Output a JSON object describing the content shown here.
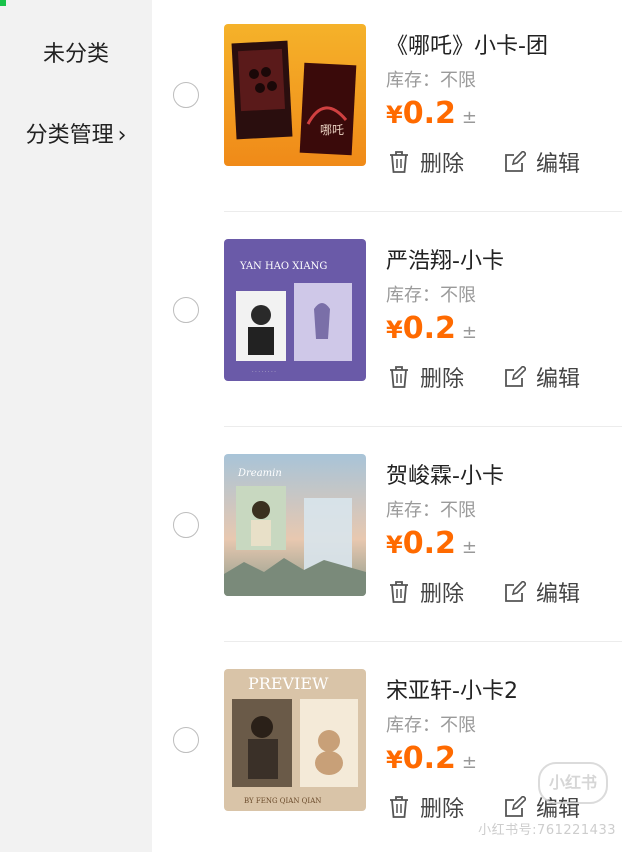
{
  "sidebar": {
    "items": [
      {
        "label": "未分类"
      },
      {
        "label": "分类管理"
      }
    ],
    "chevron_icon": "chevron-right-icon"
  },
  "products": [
    {
      "name": "《哪吒》小卡-团",
      "stock": "库存：不限",
      "currency": "¥",
      "price": "0.2",
      "price_suffix": "±",
      "delete_label": "删除",
      "edit_label": "编辑"
    },
    {
      "name": "严浩翔-小卡",
      "stock": "库存：不限",
      "currency": "¥",
      "price": "0.2",
      "price_suffix": "±",
      "delete_label": "删除",
      "edit_label": "编辑"
    },
    {
      "name": "贺峻霖-小卡",
      "stock": "库存：不限",
      "currency": "¥",
      "price": "0.2",
      "price_suffix": "±",
      "delete_label": "删除",
      "edit_label": "编辑"
    },
    {
      "name": "宋亚轩-小卡2",
      "stock": "库存：不限",
      "currency": "¥",
      "price": "0.2",
      "price_suffix": "±",
      "delete_label": "删除",
      "edit_label": "编辑"
    }
  ],
  "thumbs": [
    {
      "text": "",
      "bg": "#f0a020"
    },
    {
      "text": "YAN HAO XIANG",
      "bg": "#6a5aa8"
    },
    {
      "text": "Dreamin",
      "bg": "#9cb6c8"
    },
    {
      "text": "PREVIEW",
      "bg": "#d9c4a8"
    }
  ],
  "watermark": {
    "logo": "小红书",
    "id_text": "小红书号:761221433"
  },
  "colors": {
    "price": "#ff6a00",
    "sidebar_bg": "#f2f2f2",
    "accent_green": "#19c34a"
  }
}
